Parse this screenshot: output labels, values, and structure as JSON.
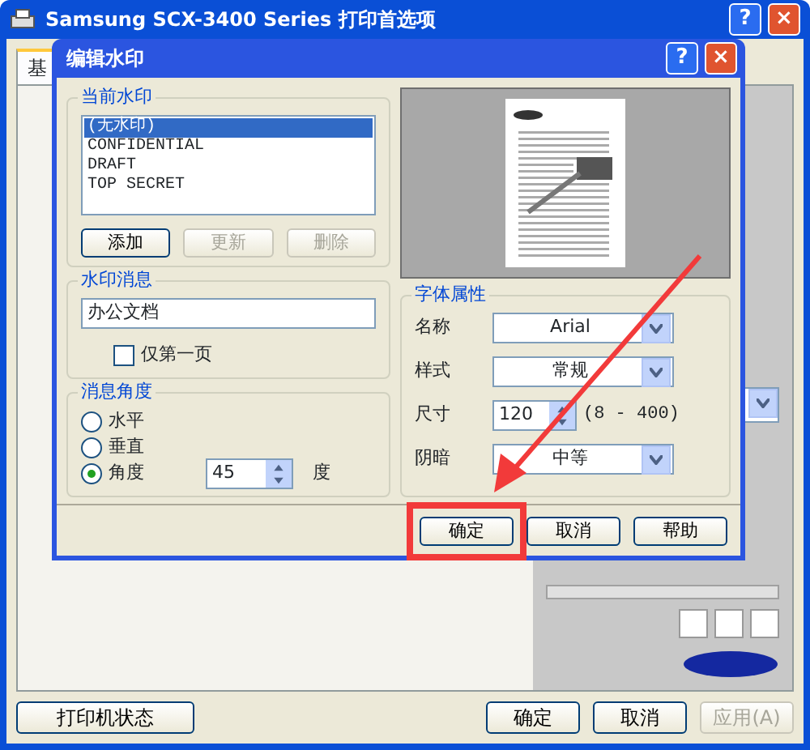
{
  "back_window": {
    "title": "Samsung SCX-3400 Series 打印首选项",
    "title_buttons": [
      "?",
      "×"
    ],
    "tab": {
      "label": "基",
      "selected": true
    },
    "buttons": [
      {
        "label": "打印机状态",
        "disabled": false
      },
      {
        "label": "确定",
        "disabled": false
      },
      {
        "label": "取消",
        "disabled": false
      },
      {
        "label": "应用(A)",
        "disabled": true
      }
    ]
  },
  "dialog": {
    "title": "编辑水印",
    "title_buttons": [
      "?",
      "×"
    ],
    "current_watermark": {
      "title": "当前水印",
      "items": [
        {
          "label": "(无水印)",
          "selected": true
        },
        {
          "label": "CONFIDENTIAL",
          "selected": false
        },
        {
          "label": "DRAFT",
          "selected": false
        },
        {
          "label": "TOP SECRET",
          "selected": false
        }
      ],
      "buttons": [
        {
          "label": "添加",
          "disabled": false
        },
        {
          "label": "更新",
          "disabled": true
        },
        {
          "label": "删除",
          "disabled": true
        }
      ]
    },
    "message": {
      "title": "水印消息",
      "value": "办公文档",
      "checkbox": {
        "label": "仅第一页",
        "checked": false
      }
    },
    "angle": {
      "title": "消息角度",
      "options": [
        {
          "label": "水平",
          "selected": false
        },
        {
          "label": "垂直",
          "selected": false
        },
        {
          "label": "角度",
          "selected": true
        }
      ],
      "value": "45",
      "unit": "度"
    },
    "font": {
      "title": "字体属性",
      "fields": [
        {
          "kind": "select",
          "label": "名称",
          "value": "Arial"
        },
        {
          "kind": "select",
          "label": "样式",
          "value": "常规"
        },
        {
          "kind": "spin",
          "label": "尺寸",
          "value": "120",
          "hint": "(8 - 400)"
        },
        {
          "kind": "select",
          "label": "阴暗",
          "value": "中等"
        }
      ]
    },
    "buttons": [
      {
        "label": "确定"
      },
      {
        "label": "取消"
      },
      {
        "label": "帮助"
      }
    ]
  },
  "annotations": [
    {
      "kind": "arrow-to-box"
    }
  ]
}
